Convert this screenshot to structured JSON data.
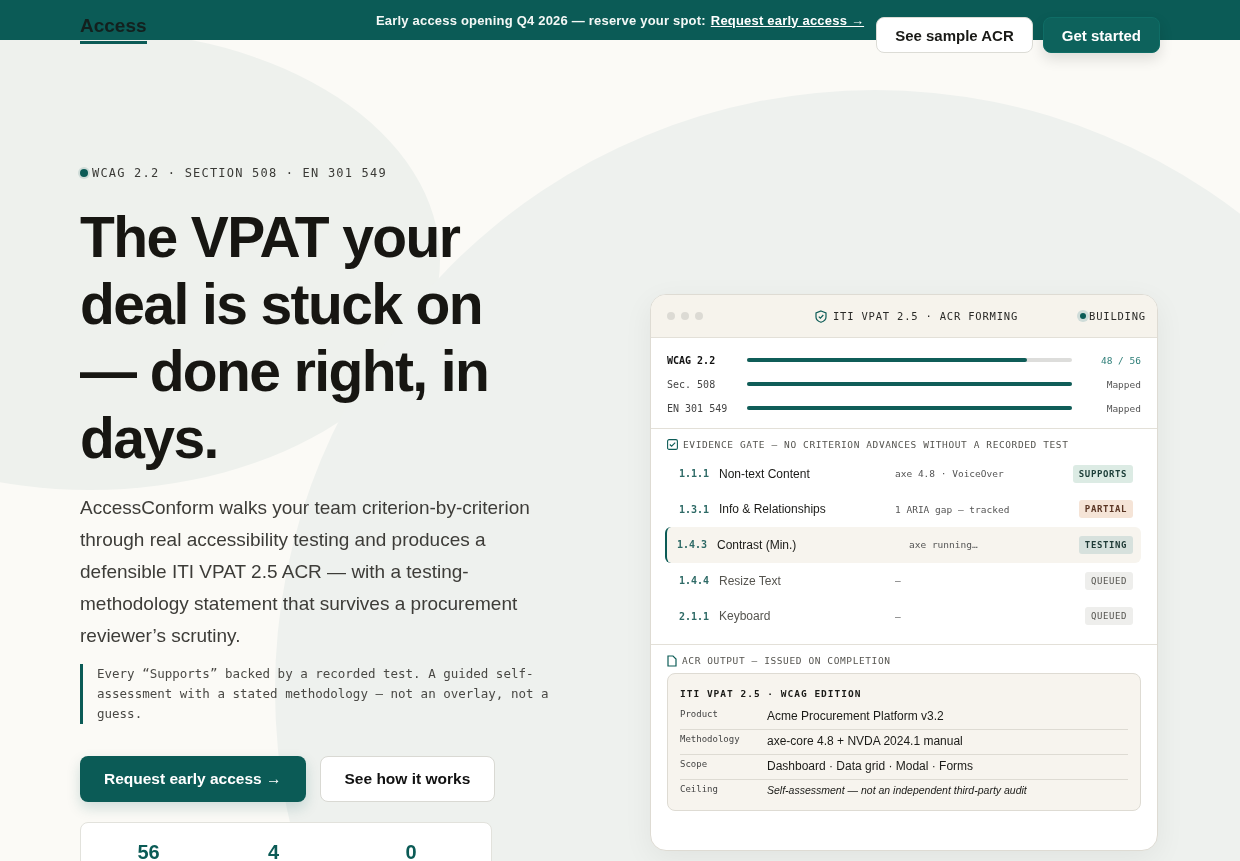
{
  "banner": {
    "text": "Early access opening Q4 2026 — reserve your spot:",
    "link": "Request early access →"
  },
  "header": {
    "logo": "Access",
    "buttons": [
      {
        "label": "See sample ACR",
        "kind": "secondary"
      },
      {
        "label": "Get started",
        "kind": "primary"
      }
    ]
  },
  "hero": {
    "eyebrow": "WCAG 2.2 · SECTION 508 · EN 301 549",
    "title": "The VPAT your deal is stuck on — done right, in days.",
    "body": "AccessConform walks your team criterion-by-criterion through real accessibility testing and produces a defensible ITI VPAT 2.5 ACR — with a testing-methodology statement that survives a procurement reviewer’s scrutiny.",
    "quote": "Every “Supports” backed by a recorded test. A guided self-assessment with a stated methodology — not an overlay, not a guess.",
    "buttons": [
      {
        "label": "Request early access →",
        "kind": "primary"
      },
      {
        "label": "See how it works",
        "kind": "secondary"
      }
    ],
    "stats": [
      "56",
      "4",
      "0"
    ]
  },
  "card": {
    "title": "ITI VPAT 2.5 · ACR FORMING",
    "status": "BUILDING",
    "standards": [
      {
        "name": "WCAG 2.2",
        "level": 0.86,
        "reading": "48 / 56",
        "selected": true
      },
      {
        "name": "Sec. 508",
        "level": 1,
        "reading": "Mapped",
        "selected": false
      },
      {
        "name": "EN 301 549",
        "level": 1,
        "reading": "Mapped",
        "selected": false
      }
    ],
    "gate_title": "EVIDENCE GATE — NO CRITERION ADVANCES WITHOUT A RECORDED TEST",
    "criteria": [
      {
        "id": "1.1.1",
        "name": "Non-text Content",
        "evidence": "axe 4.8 · VoiceOver",
        "status": "SUPPORTS",
        "kind": "supports",
        "selected": false
      },
      {
        "id": "1.3.1",
        "name": "Info & Relationships",
        "evidence": "1 ARIA gap — tracked",
        "status": "PARTIAL",
        "kind": "partial",
        "selected": false
      },
      {
        "id": "1.4.3",
        "name": "Contrast (Min.)",
        "evidence": "axe running…",
        "status": "TESTING",
        "kind": "testing",
        "selected": true
      },
      {
        "id": "1.4.4",
        "name": "Resize Text",
        "evidence": "—",
        "status": "QUEUED",
        "kind": "queued",
        "selected": false
      },
      {
        "id": "2.1.1",
        "name": "Keyboard",
        "evidence": "—",
        "status": "QUEUED",
        "kind": "queued",
        "selected": false
      }
    ],
    "output_title": "ACR OUTPUT — ISSUED ON COMPLETION",
    "output": {
      "heading": "ITI VPAT 2.5 · WCAG EDITION",
      "rows": [
        {
          "label": "Product",
          "value": "Acme Procurement Platform v3.2",
          "italic": false
        },
        {
          "label": "Methodology",
          "value": "axe-core 4.8 + NVDA 2024.1 manual",
          "italic": false
        },
        {
          "label": "Scope",
          "value": "Dashboard · Data grid · Modal · Forms",
          "italic": false
        },
        {
          "label": "Ceiling",
          "value": "Self-assessment — not an independent third-party audit",
          "italic": true
        }
      ]
    }
  }
}
